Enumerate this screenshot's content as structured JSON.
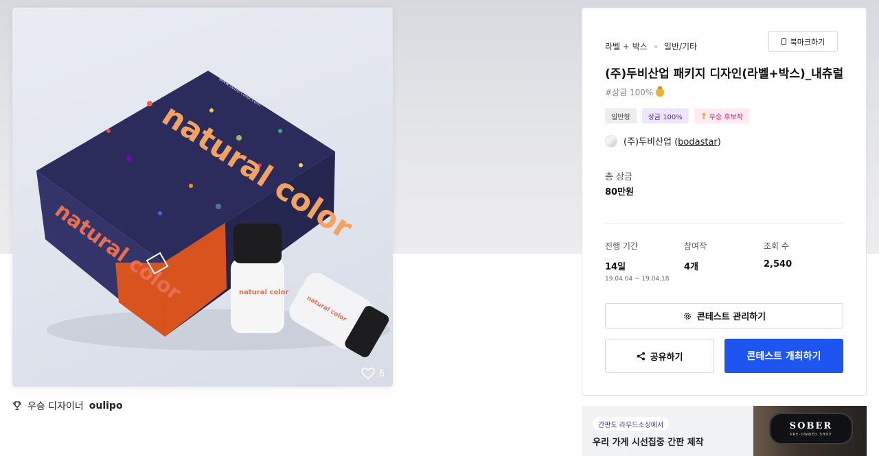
{
  "image": {
    "like_count": "6",
    "box_text": {
      "brand_top": "natural color",
      "brand_side": "natural color",
      "bottle": "natural color",
      "url": "www.sobercolor.com"
    }
  },
  "award": {
    "prefix": "우승 디자이너",
    "designer": "oulipo"
  },
  "panel": {
    "crumbs": [
      "라벨 + 박스",
      "일반/기타"
    ],
    "bookmark_label": "북마크하기",
    "title": "(주)두비산업 패키지 디자인(라벨+박스)_내츄럴",
    "hashtag": "#상금 100%",
    "badges": [
      "일반형",
      "상금 100%",
      "우승 후보작"
    ],
    "owner": {
      "name": "(주)두비산업",
      "handle": "bodastar",
      "paren_open": "(",
      "paren_close": ")"
    },
    "prize": {
      "label": "총 상금",
      "value": "80만원"
    },
    "stats": [
      {
        "label": "진행 기간",
        "value": "14일",
        "range": "19.04.04 ~ 19.04.18"
      },
      {
        "label": "참여작",
        "value": "4개"
      },
      {
        "label": "조회 수",
        "value": "2,540"
      }
    ],
    "buttons": {
      "manage": "콘테스트 관리하기",
      "share": "공유하기",
      "host": "콘테스트 개최하기"
    }
  },
  "banner": {
    "tag": "간판도 라우드소싱에서",
    "headline": "우리 가게 시선집중 간판 제작",
    "sign_main": "SOBER",
    "sign_sub": "PRE-OWNED SHOP"
  },
  "colors": {
    "primary_button": "#1d55f0",
    "box_navy": "#2b2c5c",
    "box_orange": "#d9531f"
  }
}
